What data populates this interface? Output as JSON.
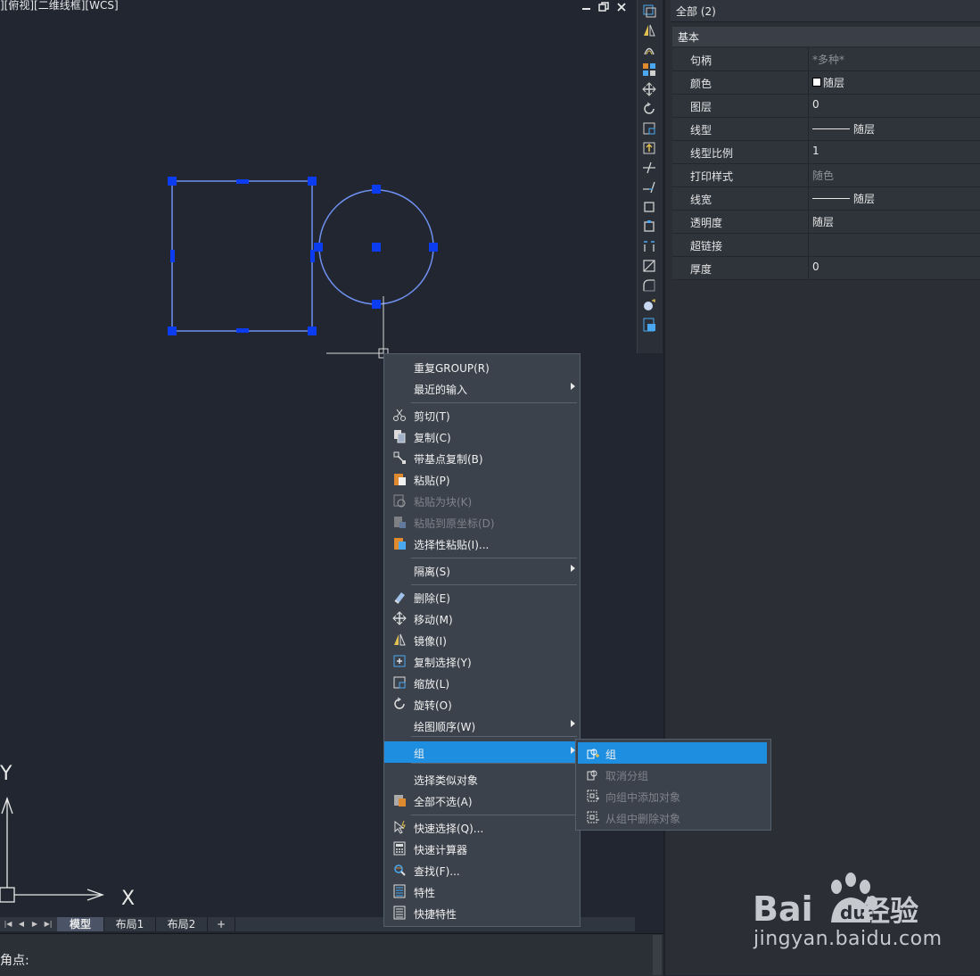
{
  "viewport": {
    "label": "][俯视][二维线框][WCS]",
    "axis_x": "X",
    "axis_y": "Y"
  },
  "window_controls": {
    "minimize": "▬",
    "restore": "⧉",
    "close": "✕"
  },
  "properties": {
    "selection": "全部 (2)",
    "category": "基本",
    "rows": [
      {
        "key": "句柄",
        "value": "*多种*",
        "dim": true
      },
      {
        "key": "颜色",
        "value": "随层",
        "swatch": "#ffffff"
      },
      {
        "key": "图层",
        "value": "0"
      },
      {
        "key": "线型",
        "value": "随层",
        "line": true
      },
      {
        "key": "线型比例",
        "value": "1"
      },
      {
        "key": "打印样式",
        "value": "随色",
        "dim": true
      },
      {
        "key": "线宽",
        "value": "随层",
        "line": true
      },
      {
        "key": "透明度",
        "value": "随层"
      },
      {
        "key": "超链接",
        "value": ""
      },
      {
        "key": "厚度",
        "value": "0"
      }
    ]
  },
  "layout_tabs": [
    "模型",
    "布局1",
    "布局2",
    "+"
  ],
  "command_line": "角点:",
  "context_menu": {
    "items": [
      {
        "label": "重复GROUP(R)",
        "icon": ""
      },
      {
        "label": "最近的输入",
        "icon": "",
        "submenu": true
      },
      {
        "label": "剪切(T)",
        "icon": "scissors-icon"
      },
      {
        "label": "复制(C)",
        "icon": "copy-icon"
      },
      {
        "label": "带基点复制(B)",
        "icon": "copy-base-icon"
      },
      {
        "label": "粘贴(P)",
        "icon": "paste-icon"
      },
      {
        "label": "粘贴为块(K)",
        "icon": "paste-block-icon",
        "disabled": true
      },
      {
        "label": "粘贴到原坐标(D)",
        "icon": "paste-orig-icon",
        "disabled": true
      },
      {
        "label": "选择性粘贴(I)...",
        "icon": "paste-special-icon"
      },
      {
        "label": "隔离(S)",
        "icon": "",
        "submenu": true
      },
      {
        "label": "删除(E)",
        "icon": "eraser-icon"
      },
      {
        "label": "移动(M)",
        "icon": "move-icon"
      },
      {
        "label": "镜像(I)",
        "icon": "mirror-icon"
      },
      {
        "label": "复制选择(Y)",
        "icon": "copy-select-icon"
      },
      {
        "label": "缩放(L)",
        "icon": "scale-icon"
      },
      {
        "label": "旋转(O)",
        "icon": "rotate-icon"
      },
      {
        "label": "绘图顺序(W)",
        "icon": "",
        "submenu": true
      },
      {
        "label": "组",
        "icon": "",
        "submenu": true,
        "highlighted": true
      },
      {
        "label": "选择类似对象",
        "icon": ""
      },
      {
        "label": "全部不选(A)",
        "icon": "deselect-icon"
      },
      {
        "label": "快速选择(Q)...",
        "icon": "quick-select-icon"
      },
      {
        "label": "快速计算器",
        "icon": "calculator-icon"
      },
      {
        "label": "查找(F)...",
        "icon": "find-icon"
      },
      {
        "label": "特性",
        "icon": "properties-icon"
      },
      {
        "label": "快捷特性",
        "icon": "quick-properties-icon"
      }
    ]
  },
  "submenu": {
    "items": [
      {
        "label": "组",
        "highlighted": true
      },
      {
        "label": "取消分组",
        "disabled": true
      },
      {
        "label": "向组中添加对象",
        "disabled": true
      },
      {
        "label": "从组中删除对象",
        "disabled": true
      }
    ]
  },
  "watermark": {
    "brand": "Bai du 经验",
    "url": "jingyan.baidu.com"
  },
  "colors": {
    "accent": "#1e8ee0",
    "grip": "#0b3cf0",
    "entity": "#6f8ff0"
  }
}
